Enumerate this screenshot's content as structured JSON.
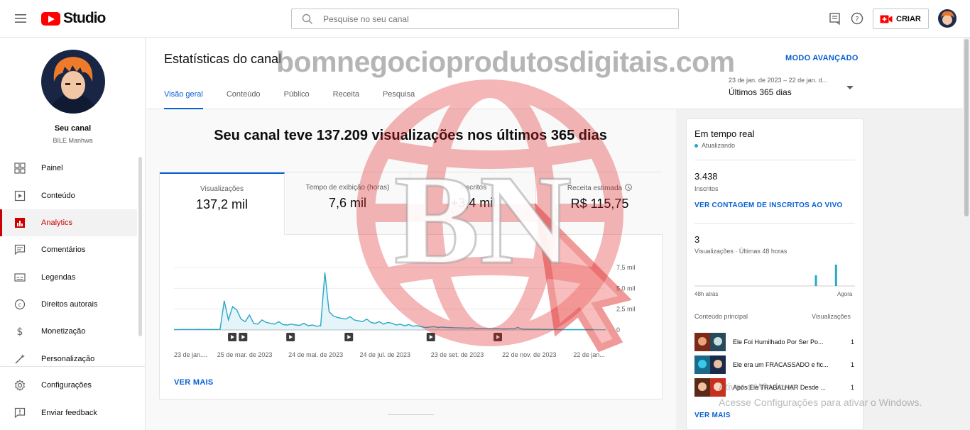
{
  "header": {
    "logo_text": "Studio",
    "search_placeholder": "Pesquise no seu canal",
    "create_label": "CRIAR"
  },
  "sidebar": {
    "channel_title": "Seu canal",
    "channel_name": "BILE Manhwa",
    "items": [
      {
        "label": "Painel",
        "icon": "dashboard-icon"
      },
      {
        "label": "Conteúdo",
        "icon": "content-icon"
      },
      {
        "label": "Analytics",
        "icon": "analytics-icon",
        "active": true
      },
      {
        "label": "Comentários",
        "icon": "comments-icon"
      },
      {
        "label": "Legendas",
        "icon": "subtitles-icon"
      },
      {
        "label": "Direitos autorais",
        "icon": "copyright-icon"
      },
      {
        "label": "Monetização",
        "icon": "dollar-icon"
      },
      {
        "label": "Personalização",
        "icon": "wand-icon"
      }
    ],
    "bottom_items": [
      {
        "label": "Configurações",
        "icon": "gear-icon"
      },
      {
        "label": "Enviar feedback",
        "icon": "feedback-icon"
      }
    ]
  },
  "page": {
    "title": "Estatísticas do canal",
    "advanced_mode": "MODO AVANÇADO",
    "tabs": [
      "Visão geral",
      "Conteúdo",
      "Público",
      "Receita",
      "Pesquisa"
    ],
    "active_tab": "Visão geral",
    "date_range_small": "23 de jan. de 2023 – 22 de jan. d...",
    "date_range_label": "Últimos 365 dias"
  },
  "overview": {
    "headline": "Seu canal teve 137.209 visualizações nos últimos 365 dias",
    "metrics": [
      {
        "label": "Visualizações",
        "value": "137,2 mil"
      },
      {
        "label": "Tempo de exibição (horas)",
        "value": "7,6 mil"
      },
      {
        "label": "Inscritos",
        "value": "+3,4 mil"
      },
      {
        "label": "Receita estimada",
        "value": "R$ 115,75",
        "info_icon": "info-icon"
      }
    ],
    "see_more": "VER MAIS"
  },
  "chart_data": {
    "type": "area",
    "series": [
      {
        "values": [
          60,
          55,
          58,
          62,
          60,
          58,
          65,
          60,
          62,
          58,
          60,
          62,
          3500,
          1200,
          2800,
          2400,
          1300,
          1000,
          1800,
          800,
          700,
          1200,
          900,
          800,
          700,
          1000,
          650,
          600,
          700,
          600,
          550,
          800,
          500,
          600,
          450,
          500,
          6900,
          2200,
          1700,
          1500,
          1400,
          1300,
          1600,
          1200,
          1100,
          1000,
          1300,
          900,
          800,
          1000,
          700,
          900,
          800,
          600,
          700,
          500,
          650,
          450,
          500,
          400,
          300,
          350,
          400,
          300,
          350,
          300,
          280,
          260,
          250,
          240,
          220,
          250,
          200,
          180,
          200,
          160,
          150,
          170,
          140,
          130,
          150,
          120,
          300,
          110,
          100,
          90,
          80,
          85,
          70,
          65,
          60,
          55,
          60,
          50,
          45,
          40,
          45,
          40,
          35,
          30,
          35,
          30,
          28,
          25
        ]
      }
    ],
    "x_labels": [
      "23 de jan....",
      "25 de mar. de 2023",
      "24 de mai. de 2023",
      "24 de jul. de 2023",
      "23 de set. de 2023",
      "22 de nov. de 2023",
      "22 de jan..."
    ],
    "y_ticks": [
      "0",
      "2,5 mil",
      "5,0 mil",
      "7,5 mil"
    ],
    "ylim": [
      0,
      7500
    ],
    "markers": [
      "video-marker",
      "video-marker",
      "video-marker",
      "video-marker",
      "video-marker",
      "video-marker"
    ],
    "color": "#28a8c7",
    "grid": true
  },
  "realtime": {
    "title": "Em tempo real",
    "status": "Atualizando",
    "subscribers_value": "3.438",
    "subscribers_label": "Inscritos",
    "live_count_link": "VER CONTAGEM DE INSCRITOS AO VIVO",
    "views_value": "3",
    "views_label": "Visualizações · Últimas 48 horas",
    "mini_chart": {
      "type": "bar",
      "values": [
        0,
        0,
        0,
        0,
        0,
        0,
        0,
        0,
        0,
        0,
        0,
        0,
        0,
        0,
        0,
        0,
        0,
        0,
        0,
        0,
        0,
        0,
        0,
        0,
        0,
        0,
        0,
        0,
        0,
        0,
        0,
        0,
        0,
        0,
        0,
        0,
        1,
        0,
        0,
        0,
        0,
        0,
        2,
        0,
        0,
        0,
        0,
        0
      ]
    },
    "axis_left": "48h atrás",
    "axis_right": "Agora",
    "top_content_label": "Conteúdo principal",
    "views_col_label": "Visualizações",
    "videos": [
      {
        "title": "Ele Foi Humilhado Por Ser Po...",
        "views": "1"
      },
      {
        "title": "Ele era um FRACASSADO e fic...",
        "views": "1"
      },
      {
        "title": "Após Ele TRABALHAR Desde ...",
        "views": "1"
      }
    ],
    "see_more": "VER MAIS"
  },
  "overlays": {
    "watermark_text": "bomnegocioprodutosdigitais.com",
    "watermark_logo": "BN",
    "activation_line1": "Ativar o Windows",
    "activation_line2": "Acesse Configurações para ativar o Windows."
  },
  "colors": {
    "accent": "#065fd4",
    "brand_red": "#ff0000",
    "active_nav": "#cc0000",
    "chart_line": "#28a8c7"
  }
}
